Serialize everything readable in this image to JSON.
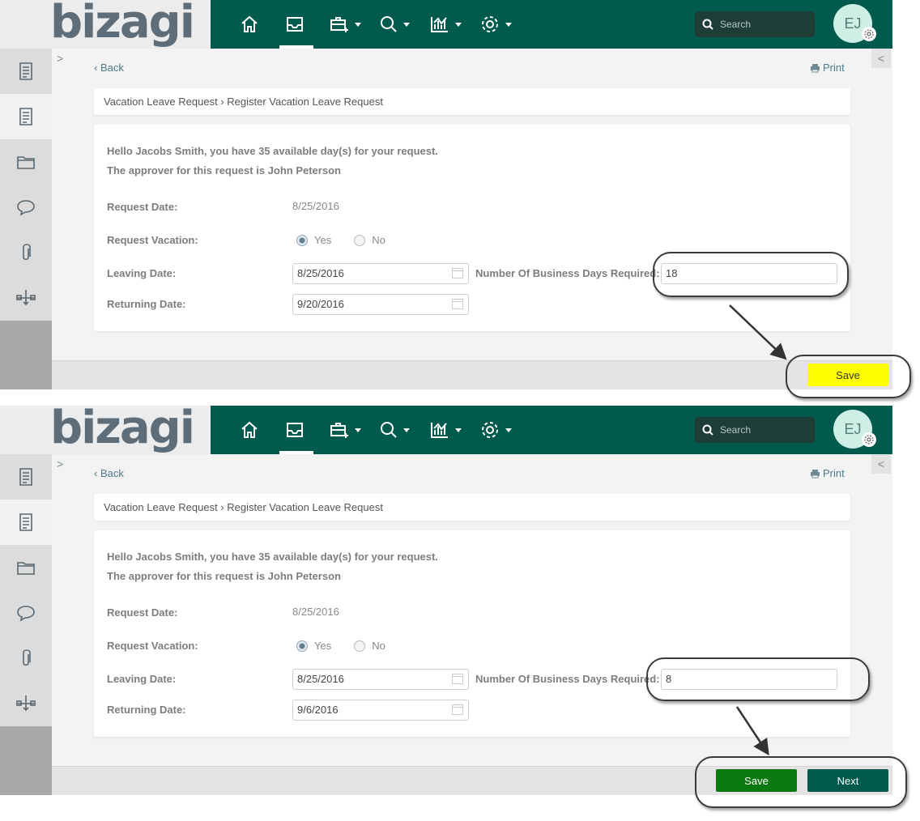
{
  "app": {
    "logo": "bizagi",
    "search_placeholder": "Search",
    "avatar_initials": "EJ",
    "nav_icons": [
      "home-icon",
      "inbox-icon",
      "new-case-icon",
      "search-icon",
      "reports-icon",
      "settings-icon"
    ],
    "rail_icons": [
      "form-icon",
      "form-icon",
      "folder-icon",
      "chat-icon",
      "paperclip-icon",
      "workflow-icon"
    ],
    "colors": {
      "topbar": "#005a4e",
      "save_yellow": "#ffff00",
      "save_green": "#0a7a10",
      "next": "#00594d"
    }
  },
  "nav": {
    "back": "Back",
    "print": "Print"
  },
  "breadcrumb": "Vacation Leave Request › Register Vacation Leave Request",
  "form": {
    "greeting": "Hello Jacobs Smith, you have 35 available day(s) for your request.",
    "approver": "The approver for this request is John Peterson",
    "request_date_label": "Request Date:",
    "request_date_value": "8/25/2016",
    "request_vacation_label": "Request Vacation:",
    "yes": "Yes",
    "no": "No",
    "leaving_date_label": "Leaving Date:",
    "returning_date_label": "Returning Date:",
    "days_required_label": "Number Of Business Days Required:"
  },
  "screens": [
    {
      "leaving_date": "8/25/2016",
      "returning_date": "9/20/2016",
      "days_required": "18",
      "save_label": "Save"
    },
    {
      "leaving_date": "8/25/2016",
      "returning_date": "9/6/2016",
      "days_required": "8",
      "save_label": "Save",
      "next_label": "Next"
    }
  ]
}
